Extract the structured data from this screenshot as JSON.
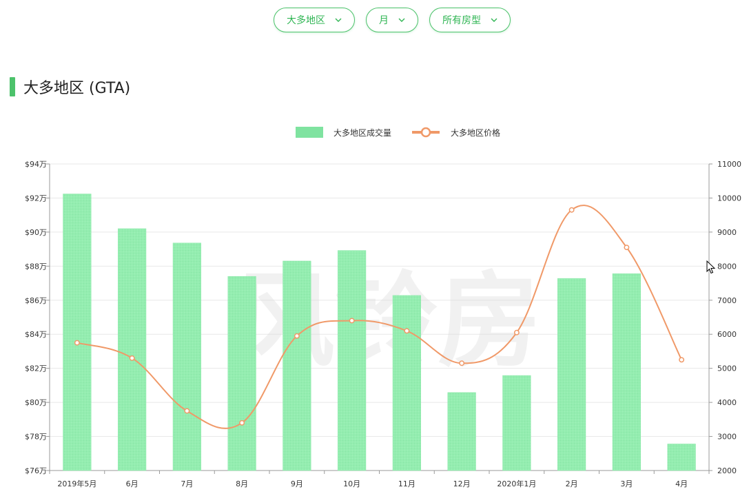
{
  "filters": {
    "region": "大多地区",
    "period": "月",
    "house_type": "所有房型"
  },
  "section": {
    "title": "大多地区 (GTA)"
  },
  "colors": {
    "accent": "#4cc26b",
    "bar": "#94edb0",
    "bar_legend": "#7fe3a0",
    "line": "#f09968"
  },
  "chart_data": {
    "type": "bar",
    "categories": [
      "2019年5月",
      "6月",
      "7月",
      "8月",
      "9月",
      "10月",
      "11月",
      "12月",
      "2020年1月",
      "2月",
      "3月",
      "4月"
    ],
    "series": [
      {
        "name": "大多地区成交量",
        "type": "bar",
        "axis": "right",
        "values": [
          10120,
          9100,
          8680,
          7700,
          8150,
          8460,
          7140,
          4290,
          4790,
          7640,
          7780,
          2780
        ]
      },
      {
        "name": "大多地区价格",
        "type": "line",
        "axis": "left",
        "values": [
          83.5,
          82.6,
          79.5,
          78.8,
          83.9,
          84.8,
          84.2,
          82.3,
          84.1,
          91.3,
          89.1,
          82.5
        ]
      }
    ],
    "y_left": {
      "min": 76,
      "max": 94,
      "ticks": [
        "$76万",
        "$78万",
        "$80万",
        "$82万",
        "$84万",
        "$86万",
        "$88万",
        "$90万",
        "$92万",
        "$94万"
      ]
    },
    "y_right": {
      "min": 2000,
      "max": 11000,
      "ticks": [
        "2000",
        "3000",
        "4000",
        "5000",
        "6000",
        "7000",
        "8000",
        "9000",
        "10000",
        "11000"
      ]
    },
    "legend_position": "top-center",
    "grid": true,
    "watermark": "风铃房"
  }
}
